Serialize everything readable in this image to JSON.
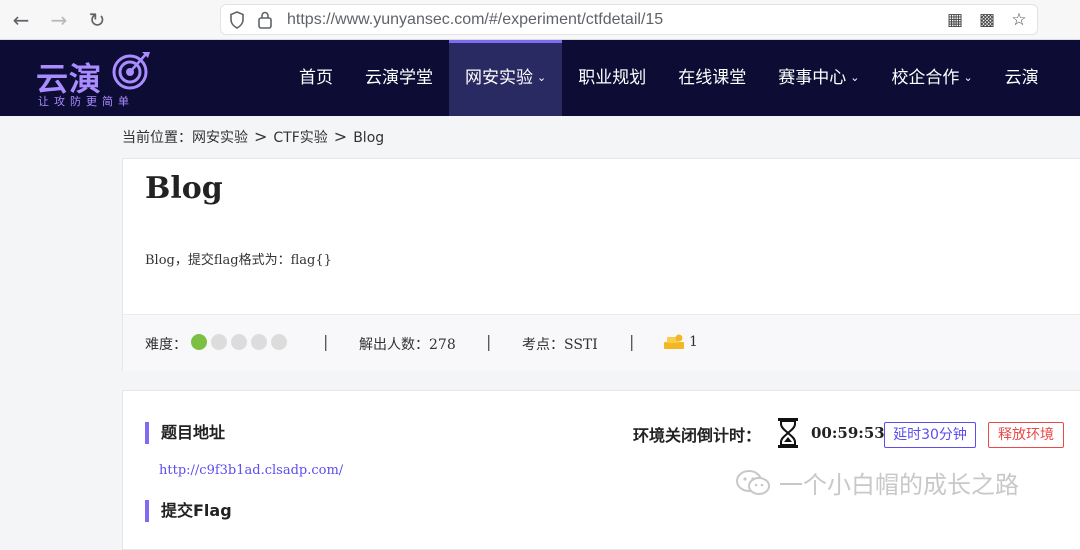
{
  "browser": {
    "url": "https://www.yunyansec.com/#/experiment/ctfdetail/15"
  },
  "site": {
    "logo_main": "云演",
    "logo_sub": "让攻防更简单",
    "nav": [
      {
        "label": "首页"
      },
      {
        "label": "云演学堂"
      },
      {
        "label": "网安实验",
        "active": true,
        "dropdown": true
      },
      {
        "label": "职业规划"
      },
      {
        "label": "在线课堂"
      },
      {
        "label": "赛事中心",
        "dropdown": true
      },
      {
        "label": "校企合作",
        "dropdown": true
      },
      {
        "label": "云演"
      }
    ],
    "accent": "#7d6bf1",
    "header_bg": "#0d0c35"
  },
  "breadcrumb": {
    "prefix": "当前位置：",
    "items": [
      "网安实验",
      "CTF实验",
      "Blog"
    ],
    "separator": ">"
  },
  "challenge": {
    "title": "Blog",
    "description": "Blog，提交flag格式为：flag{}",
    "difficulty_label": "难度：",
    "difficulty_level": 1,
    "difficulty_max": 5,
    "solved_label": "解出人数：278",
    "topic_label": "考点：SSTI",
    "reward": "1"
  },
  "environment": {
    "address_title": "题目地址",
    "address_url": "http://c9f3b1ad.clsadp.com/",
    "timer_label": "环境关闭倒计时：",
    "timer_value": "00:59:53",
    "extend_button": "延时30分钟",
    "release_button": "释放环境",
    "submit_title": "提交Flag"
  },
  "watermark": {
    "text": "一个小白帽的成长之路"
  }
}
